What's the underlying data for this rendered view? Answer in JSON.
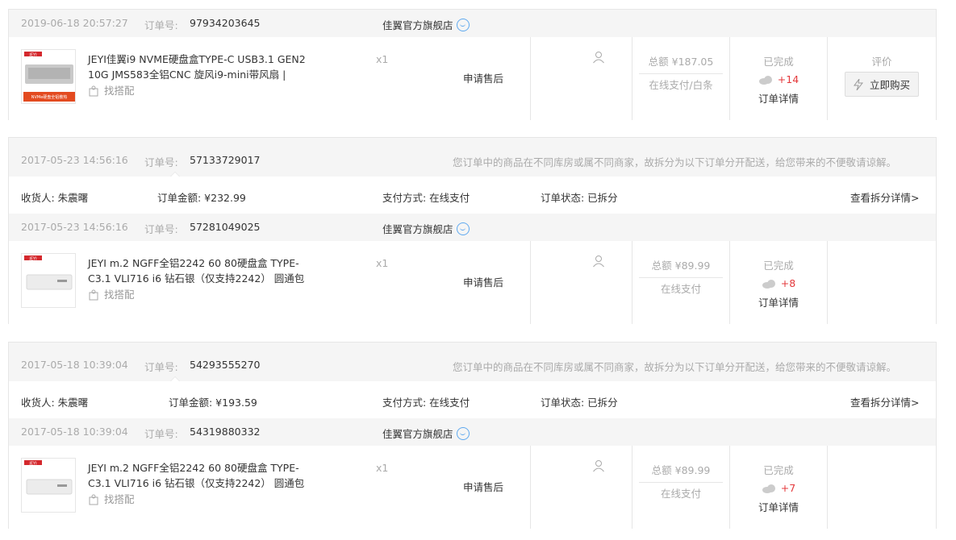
{
  "orders": [
    {
      "header": {
        "time": "2019-06-18 20:57:27",
        "order_label": "订单号:",
        "order_no": "97934203645",
        "shop": "佳翼官方旗舰店"
      },
      "item": {
        "name": "JEYI佳翼i9 NVME硬盘盒TYPE-C USB3.1 GEN2 10G JMS583全铝CNC 旋风i9-mini带风扇 |",
        "match": "找搭配",
        "qty": "x1",
        "aftersale": "申请售后",
        "amount": "总额 ¥187.05",
        "pay": "在线支付/白条",
        "status": "已完成",
        "points": "+14",
        "detail": "订单详情",
        "review": "评价",
        "buy_again": "立即购买"
      }
    },
    {
      "header": {
        "time": "2017-05-23 14:56:16",
        "order_label": "订单号:",
        "order_no": "57133729017",
        "notice": "您订单中的商品在不同库房或属不同商家，故拆分为以下订单分开配送，给您带来的不便敬请谅解。"
      },
      "summary": {
        "receiver": "收货人: 朱震曙",
        "amount": "订单金额: ¥232.99",
        "pay": "支付方式: 在线支付",
        "status": "订单状态: 已拆分",
        "split_link": "查看拆分详情>"
      },
      "sub": {
        "time": "2017-05-23 14:56:16",
        "order_label": "订单号:",
        "order_no": "57281049025",
        "shop": "佳翼官方旗舰店"
      },
      "item": {
        "name": "JEYI m.2 NGFF全铝2242 60 80硬盘盒 TYPE-C3.1 VLI716 i6 钻石银（仅支持2242） 圆通包",
        "match": "找搭配",
        "qty": "x1",
        "aftersale": "申请售后",
        "amount": "总额 ¥89.99",
        "pay": "在线支付",
        "status": "已完成",
        "points": "+8",
        "detail": "订单详情"
      }
    },
    {
      "header": {
        "time": "2017-05-18 10:39:04",
        "order_label": "订单号:",
        "order_no": "54293555270",
        "notice": "您订单中的商品在不同库房或属不同商家，故拆分为以下订单分开配送，给您带来的不便敬请谅解。"
      },
      "summary": {
        "receiver": "收货人: 朱震曙",
        "amount": "订单金额: ¥193.59",
        "pay": "支付方式: 在线支付",
        "status": "订单状态: 已拆分",
        "split_link": "查看拆分详情>"
      },
      "sub": {
        "time": "2017-05-18 10:39:04",
        "order_label": "订单号:",
        "order_no": "54319880332",
        "shop": "佳翼官方旗舰店"
      },
      "item": {
        "name": "JEYI m.2 NGFF全铝2242 60 80硬盘盒 TYPE-C3.1 VLI716 i6 钻石银（仅支持2242） 圆通包",
        "match": "找搭配",
        "qty": "x1",
        "aftersale": "申请售后",
        "amount": "总额 ¥89.99",
        "pay": "在线支付",
        "status": "已完成",
        "points": "+7",
        "detail": "订单详情"
      }
    }
  ],
  "thumb_brand": "JEYI",
  "thumb_caption": "NVMe硬盘全铝散热",
  "icons": {
    "chat": "chat-icon",
    "user": "user-icon",
    "cloud": "cloud-icon",
    "tag": "tag-icon",
    "buy": "lightning-icon"
  },
  "colors": {
    "accent_red": "#e4393c",
    "header_bg": "#f5f5f5",
    "border": "#e6e6e6",
    "chat_blue": "#5fa9ef"
  }
}
